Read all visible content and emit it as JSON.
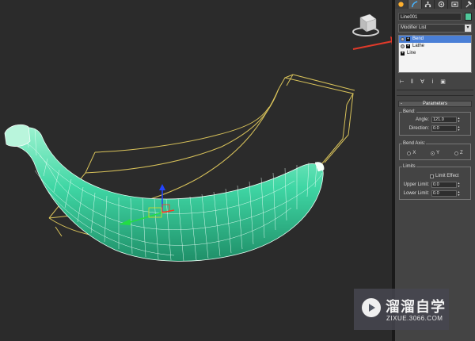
{
  "command_panel": {
    "tabs": [
      {
        "icon": "create-icon"
      },
      {
        "icon": "modify-icon",
        "active": true
      },
      {
        "icon": "hierarchy-icon"
      },
      {
        "icon": "motion-icon"
      },
      {
        "icon": "display-icon"
      },
      {
        "icon": "utilities-icon"
      }
    ],
    "object_name": "Line001",
    "object_color": "#4fc79a",
    "modifier_list_label": "Modifier List",
    "modifier_list_arrow": "▾",
    "stack": [
      {
        "label": "Bend",
        "selected": true
      },
      {
        "label": "Lathe",
        "selected": false
      },
      {
        "label": "Line",
        "selected": false
      }
    ],
    "stack_plus": "+"
  },
  "parameters": {
    "minus": "-",
    "title": "Parameters",
    "bend_group": "Bend:",
    "angle_label": "Angle:",
    "angle_value": "121.0",
    "direction_label": "Direction:",
    "direction_value": "0.0",
    "bend_axis_group": "Bend Axis:",
    "axis_x": "X",
    "axis_y": "Y",
    "axis_z": "Z",
    "limits_group": "Limits",
    "limit_effect_label": "Limit Effect",
    "upper_limit_label": "Upper Limit:",
    "upper_limit_value": "0.0",
    "lower_limit_label": "Lower Limit:",
    "lower_limit_value": "0.0",
    "spin_up": "▴",
    "spin_down": "▾"
  },
  "watermark": {
    "title": "溜溜自学",
    "url": "ZIXUE.3066.COM"
  },
  "colors": {
    "banana_mesh": "#3fd6a4",
    "gizmo_lattice": "#d8c25a",
    "annotation_arrow": "#e03a2a",
    "stack_selected": "#4a7fd6"
  }
}
